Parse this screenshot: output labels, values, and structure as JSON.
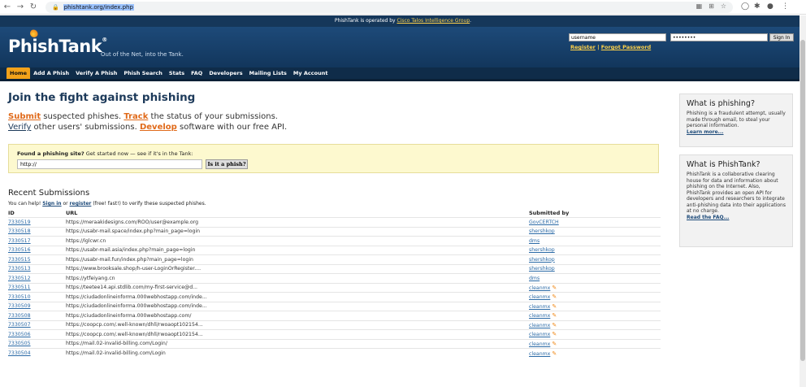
{
  "browser": {
    "url": "phishtank.org/index.php",
    "back_icon": "←",
    "forward_icon": "→",
    "reload_icon": "↻"
  },
  "opbar": {
    "text": "PhishTank is operated by ",
    "link": "Cisco Talos Intelligence Group",
    "suffix": "."
  },
  "header": {
    "logo": "PhishTank",
    "reg_mark": "®",
    "tagline": "Out of the Net, into the Tank.",
    "username_value": "username",
    "password_value": "••••••••",
    "signin_label": "Sign In",
    "register_label": "Register",
    "separator": " | ",
    "forgot_label": "Forgot Password"
  },
  "nav": {
    "items": [
      "Home",
      "Add A Phish",
      "Verify A Phish",
      "Phish Search",
      "Stats",
      "FAQ",
      "Developers",
      "Mailing Lists",
      "My Account"
    ],
    "active": "Home"
  },
  "main": {
    "title": "Join the fight against phishing",
    "submit": "Submit",
    "line1_rest": " suspected phishes. ",
    "track": "Track",
    "line1_end": " the status of your submissions.",
    "verify": "Verify",
    "line2_rest": " other users' submissions. ",
    "develop": "Develop",
    "line2_end": " software with our free API.",
    "find_q": "Found a phishing site?",
    "find_rest": " Get started now — see if it's in the Tank:",
    "find_input_value": "http://",
    "find_button": "Is it a phish?"
  },
  "recent": {
    "title": "Recent Submissions",
    "help_prefix": "You can help! ",
    "signin": "Sign in",
    "or": " or ",
    "register": "register",
    "help_suffix": " (free! fast!) to verify these suspected phishes.",
    "headers": [
      "ID",
      "URL",
      "Submitted by"
    ],
    "rows": [
      {
        "id": "7330519",
        "url": "https://meraakidesigns.com/ROO/user@example.org",
        "by": "GovCERTCH",
        "pencil": false
      },
      {
        "id": "7330518",
        "url": "https://usabr-mail.space/index.php?main_page=login",
        "by": "shershkop",
        "pencil": false
      },
      {
        "id": "7330517",
        "url": "https://lglcwr.cn",
        "by": "dms",
        "pencil": false
      },
      {
        "id": "7330516",
        "url": "https://usabr-mail.asia/index.php?main_page=login",
        "by": "shershkop",
        "pencil": false
      },
      {
        "id": "7330515",
        "url": "https://usabr-mail.fun/index.php?main_page=login",
        "by": "shershkop",
        "pencil": false
      },
      {
        "id": "7330513",
        "url": "https://www.brooksale.shop/h-user-LoginOrRegister....",
        "by": "shershkop",
        "pencil": false
      },
      {
        "id": "7330512",
        "url": "https://ytfeiyang.cn",
        "by": "dms",
        "pencil": false
      },
      {
        "id": "7330511",
        "url": "https://teetee14.api.stdlib.com/my-first-service@d...",
        "by": "cleanmx",
        "pencil": true
      },
      {
        "id": "7330510",
        "url": "https://ciudadonlineinforma.000webhostapp.com/inde...",
        "by": "cleanmx",
        "pencil": true
      },
      {
        "id": "7330509",
        "url": "https://ciudadonlineinforma.000webhostapp.com/inde...",
        "by": "cleanmx",
        "pencil": true
      },
      {
        "id": "7330508",
        "url": "https://ciudadonlineinforma.000webhostapp.com/",
        "by": "cleanmx",
        "pencil": true
      },
      {
        "id": "7330507",
        "url": "https://coopcp.com/.well-known/dhll/rwoaopt102154...",
        "by": "cleanmx",
        "pencil": true
      },
      {
        "id": "7330506",
        "url": "https://coopcp.com/.well-known/dhll/rwoaopt102154...",
        "by": "cleanmx",
        "pencil": true
      },
      {
        "id": "7330505",
        "url": "https://mail.02-invalid-billing.com/Login/",
        "by": "cleanmx",
        "pencil": true
      },
      {
        "id": "7330504",
        "url": "https://mail.02-invalid-billing.com/Login",
        "by": "cleanmx",
        "pencil": true
      }
    ]
  },
  "sidebar": {
    "box1_title": "What is phishing?",
    "box1_text": "Phishing is a fraudulent attempt, usually made through email, to steal your personal information.",
    "box1_link": "Learn more...",
    "box2_title": "What is PhishTank?",
    "box2_text": "PhishTank is a collaborative clearing house for data and information about phishing on the Internet. Also, PhishTank provides an open API for developers and researchers to integrate anti-phishing data into their applications at no charge.",
    "box2_link": "Read the FAQ..."
  }
}
